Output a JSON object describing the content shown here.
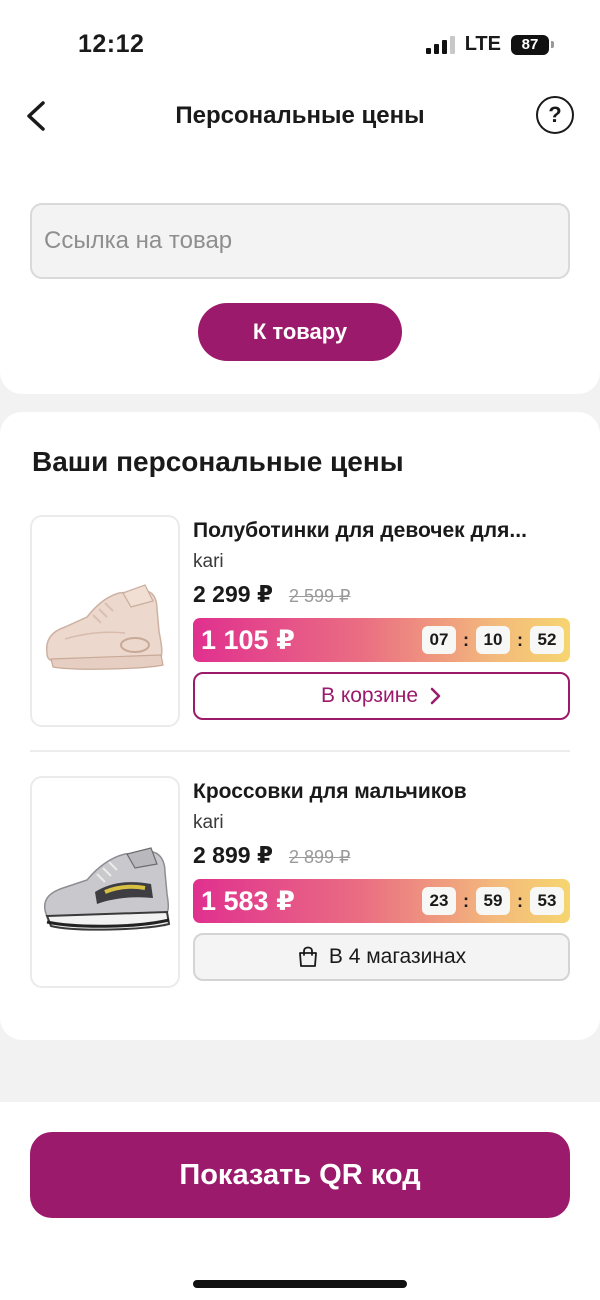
{
  "status_bar": {
    "time": "12:12",
    "network": "LTE",
    "battery": "87"
  },
  "header": {
    "title": "Персональные цены",
    "help_label": "?"
  },
  "search": {
    "placeholder": "Ссылка на товар",
    "value": "",
    "button_label": "К товару"
  },
  "section": {
    "title": "Ваши персональные цены"
  },
  "products": [
    {
      "name": "Полуботинки для девочек для...",
      "brand": "kari",
      "price": "2 299 ₽",
      "old_price": "2 599 ₽",
      "promo_price": "1 105 ₽",
      "timer": [
        "07",
        "10",
        "52"
      ],
      "action_label": "В корзине",
      "image_icon": "sneaker-pink-icon"
    },
    {
      "name": "Кроссовки для мальчиков",
      "brand": "kari",
      "price": "2 899 ₽",
      "old_price": "2 899 ₽",
      "promo_price": "1 583 ₽",
      "timer": [
        "23",
        "59",
        "53"
      ],
      "action_label": "В 4 магазинах",
      "image_icon": "sneaker-grey-icon"
    }
  ],
  "footer": {
    "qr_button_label": "Показать QR код"
  },
  "colors": {
    "accent": "#9c1a6b",
    "promo_start": "#e0308f",
    "promo_end": "#f6d56f"
  }
}
